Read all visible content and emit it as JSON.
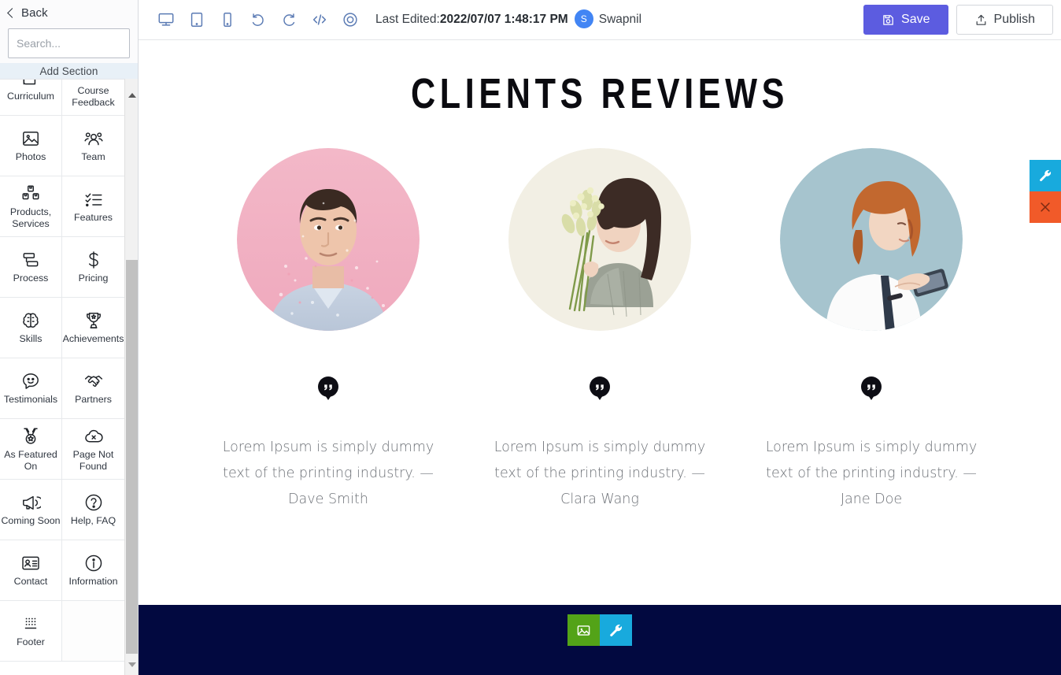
{
  "sidebar": {
    "back_label": "Back",
    "back_icon": "chevron-left-icon",
    "search": {
      "placeholder": "Search...",
      "value": ""
    },
    "add_section_label": "Add Section",
    "sections": [
      {
        "label": "Curriculum",
        "icon": "book-icon"
      },
      {
        "label": "Course Feedback",
        "icon": "bookmark-icon"
      },
      {
        "label": "Photos",
        "icon": "image-icon"
      },
      {
        "label": "Team",
        "icon": "people-icon"
      },
      {
        "label": "Products, Services",
        "icon": "boxes-icon"
      },
      {
        "label": "Features",
        "icon": "checklist-icon"
      },
      {
        "label": "Process",
        "icon": "flowchart-icon"
      },
      {
        "label": "Pricing",
        "icon": "dollar-icon"
      },
      {
        "label": "Skills",
        "icon": "brain-icon"
      },
      {
        "label": "Achievements",
        "icon": "trophy-icon"
      },
      {
        "label": "Testimonials",
        "icon": "smiley-chat-icon"
      },
      {
        "label": "Partners",
        "icon": "handshake-icon"
      },
      {
        "label": "As Featured On",
        "icon": "medal-icon"
      },
      {
        "label": "Page Not Found",
        "icon": "cloud-x-icon"
      },
      {
        "label": "Coming Soon",
        "icon": "megaphone-icon"
      },
      {
        "label": "Help, FAQ",
        "icon": "question-circle-icon"
      },
      {
        "label": "Contact",
        "icon": "contact-card-icon"
      },
      {
        "label": "Information",
        "icon": "info-circle-icon"
      },
      {
        "label": "Footer",
        "icon": "footer-dots-icon"
      }
    ],
    "scrollbar": {
      "up_arrow": "caret-up-icon",
      "down_arrow": "caret-down-icon"
    }
  },
  "toolbar": {
    "icons": [
      {
        "name": "desktop-view-icon"
      },
      {
        "name": "tablet-view-icon"
      },
      {
        "name": "mobile-view-icon"
      },
      {
        "name": "undo-icon"
      },
      {
        "name": "redo-icon"
      },
      {
        "name": "code-view-icon"
      },
      {
        "name": "preview-eye-icon"
      }
    ],
    "last_edited_label": "Last Edited:",
    "last_edited_value": "2022/07/07 1:48:17 PM",
    "user_initial": "S",
    "user_name": "Swapnil",
    "save_label": "Save",
    "save_icon": "save-disk-icon",
    "publish_label": "Publish",
    "publish_icon": "upload-icon",
    "save_color": "#5c5ce0"
  },
  "canvas": {
    "section_title": "CLIENTS REVIEWS",
    "testimonials": [
      {
        "quote_icon": "quote-pin-icon",
        "text": "Lorem Ipsum is simply dummy text of the printing industry. — Dave Smith",
        "author": "Dave Smith",
        "photo_alt": "man-with-pink-background-portrait"
      },
      {
        "quote_icon": "quote-pin-icon",
        "text": "Lorem Ipsum is simply dummy text of the printing industry. — Clara Wang",
        "author": "Clara Wang",
        "photo_alt": "woman-holding-flowers-portrait"
      },
      {
        "quote_icon": "quote-pin-icon",
        "text": "Lorem Ipsum is simply dummy text of the printing industry. — Jane Doe",
        "author": "Jane Doe",
        "photo_alt": "woman-with-phone-blue-background-portrait"
      }
    ],
    "section_tools": [
      {
        "name": "change-image-button",
        "icon": "image-icon",
        "color": "#53a318"
      },
      {
        "name": "section-settings-button",
        "icon": "wrench-icon",
        "color": "#18aadd"
      }
    ],
    "right_tools": [
      {
        "name": "edit-section-button",
        "icon": "wrench-icon",
        "color": "#18aadd"
      },
      {
        "name": "delete-section-button",
        "icon": "close-x-icon",
        "color": "#f15a29"
      }
    ],
    "footer_band_color": "#020940"
  }
}
